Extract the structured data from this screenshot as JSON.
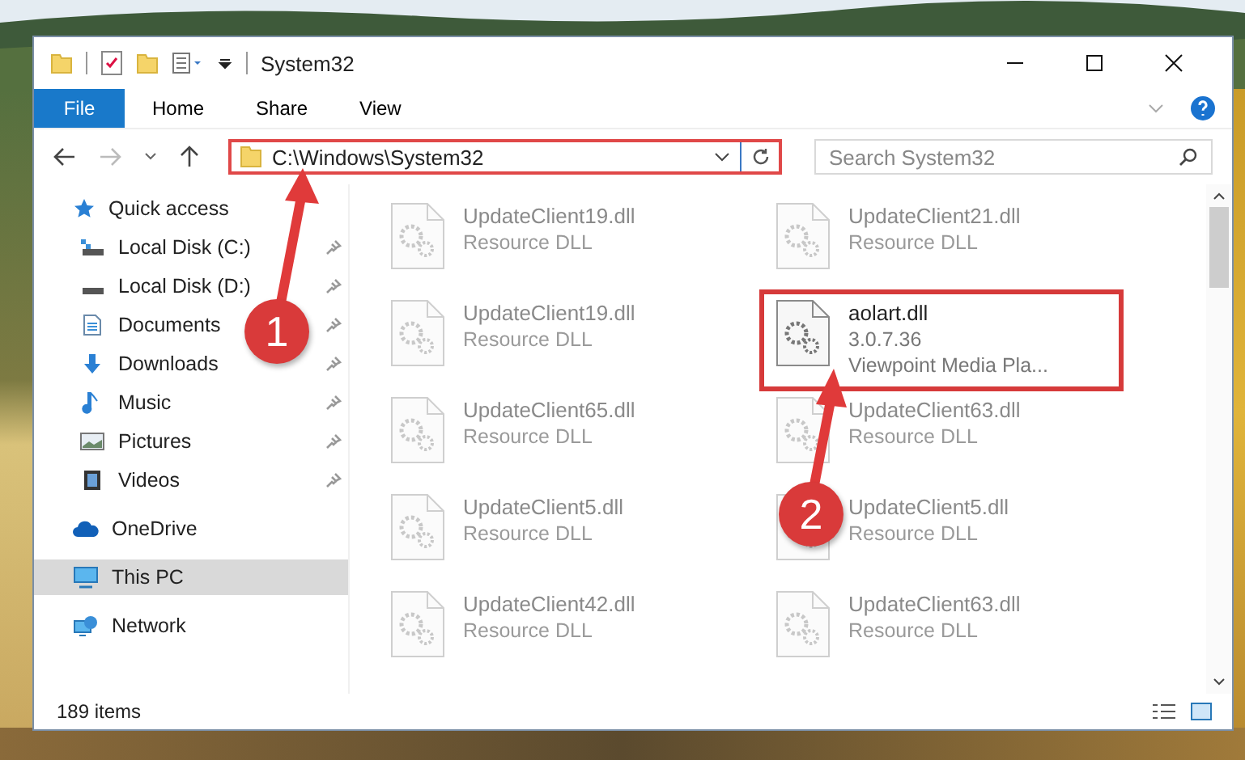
{
  "window": {
    "title": "System32"
  },
  "ribbon": {
    "tabs": [
      {
        "label": "File",
        "kind": "file"
      },
      {
        "label": "Home",
        "kind": "tab"
      },
      {
        "label": "Share",
        "kind": "tab"
      },
      {
        "label": "View",
        "kind": "tab"
      }
    ]
  },
  "address": {
    "path": "C:\\Windows\\System32",
    "highlighted": true
  },
  "search": {
    "placeholder": "Search System32"
  },
  "sidebar": {
    "items": [
      {
        "label": "Quick access",
        "kind": "star",
        "selected": false,
        "children": [
          {
            "label": "Local Disk (C:)",
            "kind": "system-drive",
            "pinned": true
          },
          {
            "label": "Local Disk (D:)",
            "kind": "drive",
            "pinned": true
          },
          {
            "label": "Documents",
            "kind": "documents",
            "pinned": true
          },
          {
            "label": "Downloads",
            "kind": "downloads",
            "pinned": true
          },
          {
            "label": "Music",
            "kind": "music",
            "pinned": true
          },
          {
            "label": "Pictures",
            "kind": "pictures",
            "pinned": true
          },
          {
            "label": "Videos",
            "kind": "videos",
            "pinned": true
          }
        ]
      },
      {
        "label": "OneDrive",
        "kind": "cloud",
        "selected": false
      },
      {
        "label": "This PC",
        "kind": "computer",
        "selected": true
      },
      {
        "label": "Network",
        "kind": "network",
        "selected": false
      }
    ]
  },
  "files": [
    {
      "name": "UpdateClient19.dll",
      "details": [
        "Resource DLL"
      ],
      "blurred": true,
      "highlighted": false
    },
    {
      "name": "UpdateClient21.dll",
      "details": [
        "Resource DLL"
      ],
      "blurred": true,
      "highlighted": false
    },
    {
      "name": "UpdateClient19.dll",
      "details": [
        "Resource DLL"
      ],
      "blurred": true,
      "highlighted": false
    },
    {
      "name": "aolart.dll",
      "details": [
        "3.0.7.36",
        "Viewpoint Media Pla..."
      ],
      "blurred": false,
      "highlighted": true
    },
    {
      "name": "UpdateClient65.dll",
      "details": [
        "Resource DLL"
      ],
      "blurred": true,
      "highlighted": false
    },
    {
      "name": "UpdateClient63.dll",
      "details": [
        "Resource DLL"
      ],
      "blurred": true,
      "highlighted": false
    },
    {
      "name": "UpdateClient5.dll",
      "details": [
        "Resource DLL"
      ],
      "blurred": true,
      "highlighted": false
    },
    {
      "name": "UpdateClient5.dll",
      "details": [
        "Resource DLL"
      ],
      "blurred": true,
      "highlighted": false
    },
    {
      "name": "UpdateClient42.dll",
      "details": [
        "Resource DLL"
      ],
      "blurred": true,
      "highlighted": false
    },
    {
      "name": "UpdateClient63.dll",
      "details": [
        "Resource DLL"
      ],
      "blurred": true,
      "highlighted": false
    }
  ],
  "status_bar": {
    "count": "189 items"
  },
  "annotations": [
    {
      "label": "1"
    },
    {
      "label": "2"
    }
  ]
}
